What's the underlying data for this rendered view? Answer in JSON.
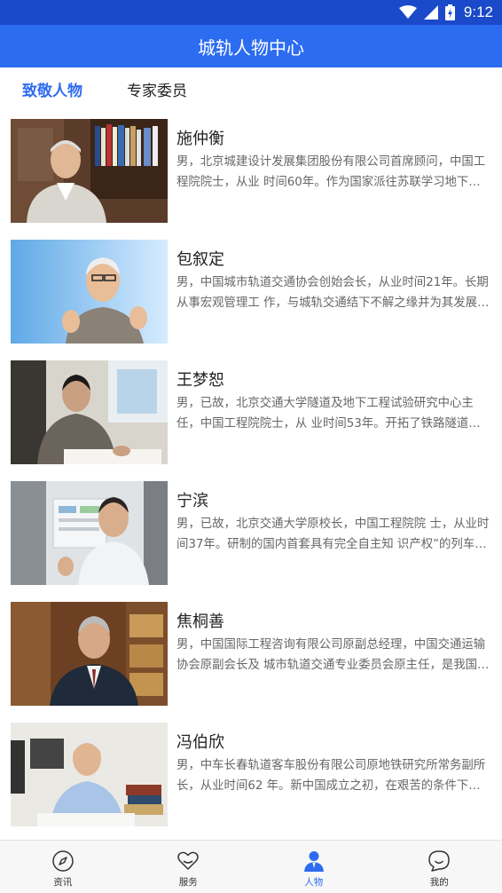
{
  "status_bar": {
    "time": "9:12",
    "icons": [
      "wifi-icon",
      "cell-signal-icon",
      "battery-charging-icon"
    ]
  },
  "header": {
    "title": "城轨人物中心"
  },
  "tabs": [
    {
      "label": "致敬人物",
      "active": true
    },
    {
      "label": "专家委员",
      "active": false
    }
  ],
  "people": [
    {
      "name": "施仲衡",
      "description": "男，北京城建设计发展集团股份有限公司首席顾问，中国工程院院士，从业 时间60年。作为国家派往苏联学习地下铁道的专家，参与主持了北京地铁的设计工作。"
    },
    {
      "name": "包叙定",
      "description": "男，中国城市轨道交通协会创始会长，从业时间21年。长期从事宏观管理工 作，与城轨交通结下不解之缘并为其发展倾注了大量心血。"
    },
    {
      "name": "王梦恕",
      "description": "男，已故，北京交通大学隧道及地下工程试验研究中心主任，中国工程院院士，从 业时间53年。开拓了铁路隧道及城市地铁暗挖施工的新方法。"
    },
    {
      "name": "宁滨",
      "description": "男，已故，北京交通大学原校长，中国工程院院 士，从业时间37年。研制的国内首套具有完全自主知 识产权”的列车运行控制系统。"
    },
    {
      "name": "焦桐善",
      "description": "男，中国国际工程咨询有限公司原副总经理，中国交通运输协会原副会长及 城市轨道交通专业委员会原主任，是我国城轨交通事业发展的亲历者。"
    },
    {
      "name": "冯伯欣",
      "description": "男，中车长春轨道客车股份有限公司原地铁研究所常务副所长，从业时间62 年。新中国成立之初，在艰苦的条件下参与研制了我国第一代地铁车辆。"
    }
  ],
  "bottom_nav": [
    {
      "label": "资讯",
      "icon": "compass-icon",
      "active": false
    },
    {
      "label": "服务",
      "icon": "heart-icon",
      "active": false
    },
    {
      "label": "人物",
      "icon": "person-icon",
      "active": true
    },
    {
      "label": "我的",
      "icon": "chat-smile-icon",
      "active": false
    }
  ],
  "colors": {
    "status_bar": "#1a49c9",
    "app_bar": "#2c6cf1",
    "accent": "#2c6cf1",
    "description_text": "#666666"
  }
}
